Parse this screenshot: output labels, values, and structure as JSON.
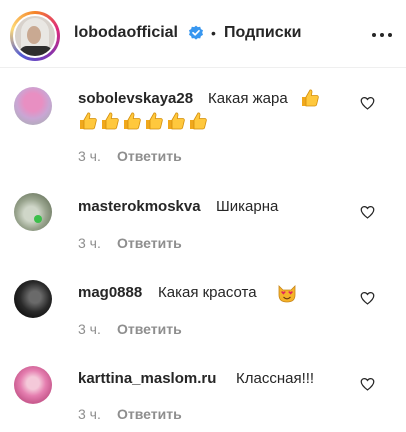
{
  "header": {
    "username": "lobodaofficial",
    "separator": "•",
    "follow_label": "Подписки"
  },
  "icons": {
    "verified": "verified-badge-icon",
    "more": "more-options-icon",
    "like": "heart-outline-icon",
    "emoji_thumbs": "thumbs-up-emoji",
    "emoji_cat": "heart-eyes-cat-emoji"
  },
  "colors": {
    "text": "#262626",
    "muted": "#8e8e8e",
    "verified": "#3897f0"
  },
  "comments": [
    {
      "username": "sobolevskaya28",
      "text": "Какая жара",
      "time": "3 ч.",
      "reply_label": "Ответить"
    },
    {
      "username": "masterokmoskva",
      "text": "Шикарна",
      "time": "3 ч.",
      "reply_label": "Ответить"
    },
    {
      "username": "mag0888",
      "text": "Какая красота",
      "time": "3 ч.",
      "reply_label": "Ответить"
    },
    {
      "username": "karttina_maslom.ru",
      "text": "Классная!!!",
      "time": "3 ч.",
      "reply_label": "Ответить"
    }
  ]
}
